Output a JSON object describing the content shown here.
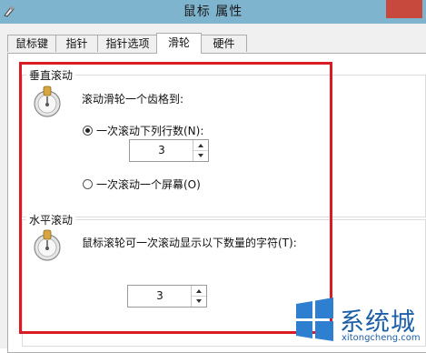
{
  "window": {
    "title": "鼠标 属性"
  },
  "tabs": [
    {
      "label": "鼠标键",
      "active": false
    },
    {
      "label": "指针",
      "active": false
    },
    {
      "label": "指针选项",
      "active": false
    },
    {
      "label": "滑轮",
      "active": true
    },
    {
      "label": "硬件",
      "active": false
    }
  ],
  "vertical_scroll": {
    "group_title": "垂直滚动",
    "prompt": "滚动滑轮一个齿格到:",
    "option_lines": {
      "label": "一次滚动下列行数(N):",
      "selected": true
    },
    "lines_value": "3",
    "option_screen": {
      "label": "一次滚动一个屏幕(O)",
      "selected": false
    }
  },
  "horizontal_scroll": {
    "group_title": "水平滚动",
    "prompt": "鼠标滚轮可一次滚动显示以下数量的字符(T):",
    "chars_value": "3"
  },
  "watermark": {
    "name": "系统城",
    "url": "xitongcheng.com"
  },
  "colors": {
    "titlebar": "#7fb4ce",
    "close": "#c7483d",
    "annotation": "#d91c24",
    "watermark": "#1d5fa8"
  }
}
